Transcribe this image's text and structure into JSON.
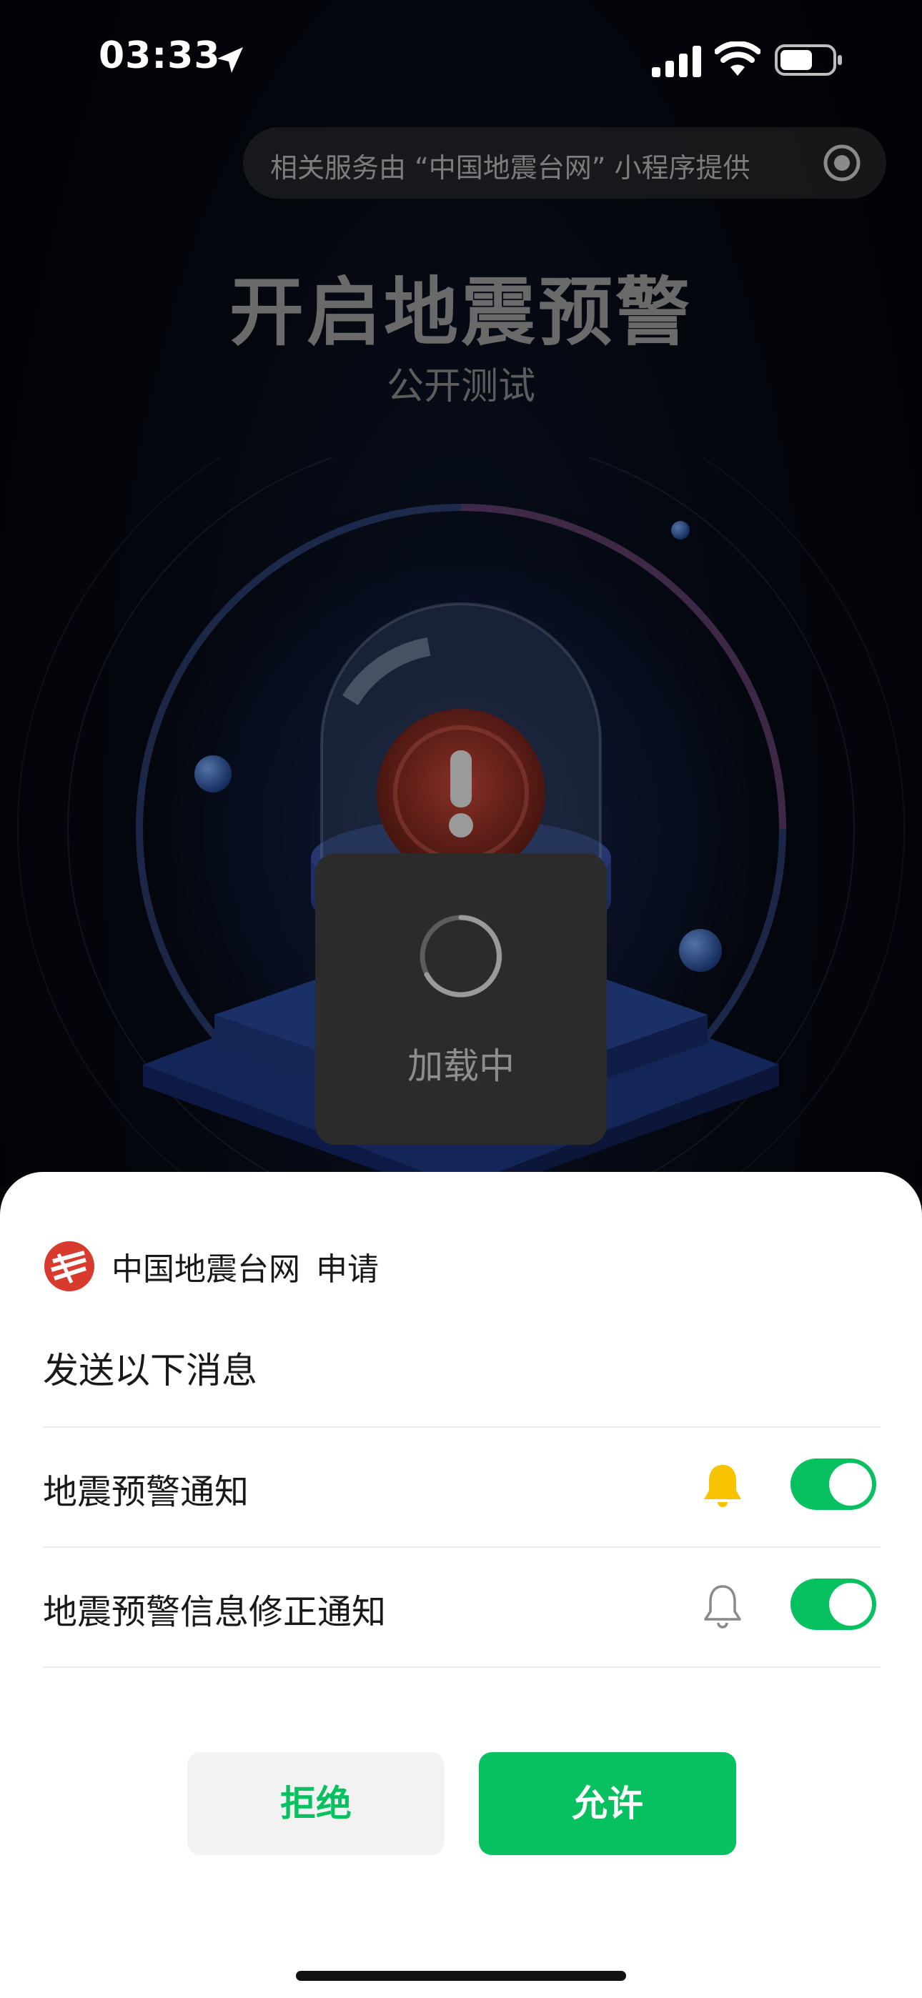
{
  "status_bar": {
    "time": "03:33",
    "icons": [
      "location-arrow-icon",
      "signal-icon",
      "wifi-icon",
      "battery-icon"
    ]
  },
  "service_pill": {
    "text": "相关服务由 “中国地震台网” 小程序提供",
    "icon": "target-icon"
  },
  "hero": {
    "title": "开启地震预警",
    "subtitle": "公开测试"
  },
  "loading_toast": {
    "text": "加载中"
  },
  "sheet": {
    "app_name": "中国地震台网",
    "request_label": "申请",
    "send_title": "发送以下消息",
    "items": [
      {
        "label": "地震预警通知",
        "bell": "bell-filled-icon",
        "bell_color": "#f7c300",
        "enabled": true
      },
      {
        "label": "地震预警信息修正通知",
        "bell": "bell-outline-icon",
        "bell_color": "#8a8a8a",
        "enabled": true
      }
    ],
    "reject_label": "拒绝",
    "allow_label": "允许"
  },
  "colors": {
    "accent": "#07c160",
    "background": "#05070c"
  }
}
